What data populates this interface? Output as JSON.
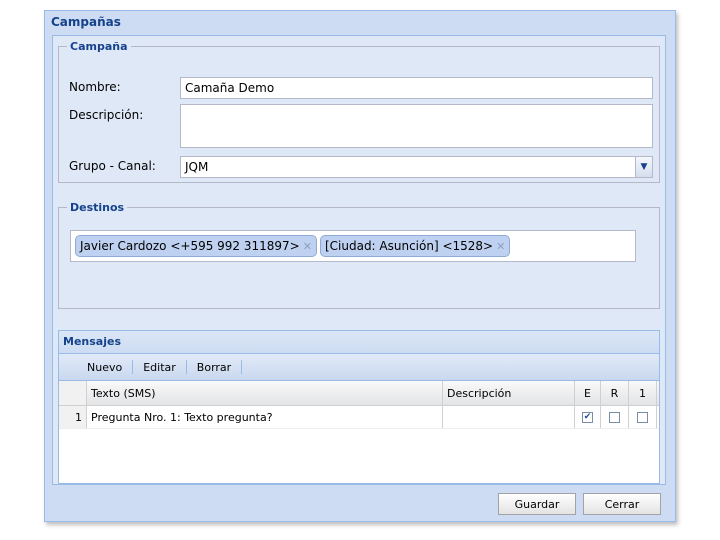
{
  "window": {
    "title": "Campañas"
  },
  "campana": {
    "legend": "Campaña",
    "nombre_label": "Nombre:",
    "nombre_value": "Camaña Demo",
    "descripcion_label": "Descripción:",
    "descripcion_value": "",
    "grupo_label": "Grupo - Canal:",
    "grupo_value": "JQM"
  },
  "destinos": {
    "legend": "Destinos",
    "tags": [
      {
        "label": "Javier Cardozo <+595 992 311897>"
      },
      {
        "label": "[Ciudad: Asunción] <1528>"
      }
    ]
  },
  "mensajes": {
    "title": "Mensajes",
    "toolbar": {
      "nuevo": "Nuevo",
      "editar": "Editar",
      "borrar": "Borrar"
    },
    "columns": {
      "texto": "Texto (SMS)",
      "descripcion": "Descripción",
      "e": "E",
      "r": "R",
      "one": "1"
    },
    "rows": [
      {
        "num": "1",
        "texto": "Pregunta Nro. 1: Texto pregunta?",
        "descripcion": "",
        "e": true,
        "r": false,
        "one": false
      }
    ]
  },
  "buttons": {
    "guardar": "Guardar",
    "cerrar": "Cerrar"
  },
  "icons": {
    "combo": "chevron-down-icon",
    "tag_remove": "close-icon"
  }
}
